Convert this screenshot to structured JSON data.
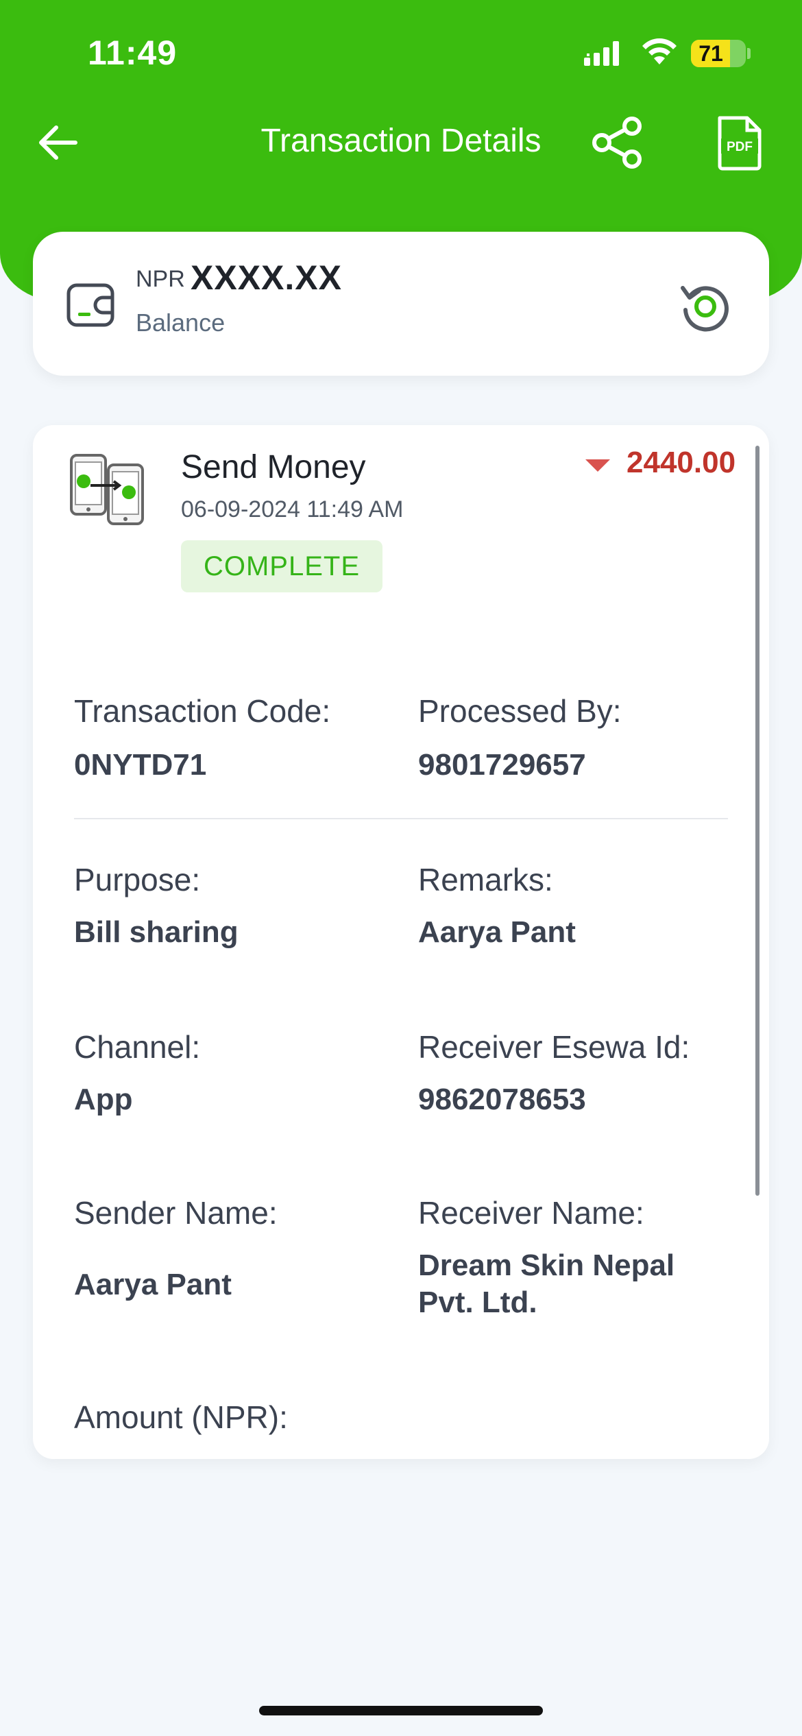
{
  "status_bar": {
    "time": "11:49",
    "battery": "71"
  },
  "nav": {
    "title": "Transaction Details"
  },
  "balance": {
    "currency": "NPR",
    "amount": "XXXX.XX",
    "label": "Balance"
  },
  "transaction": {
    "title": "Send Money",
    "date": "06-09-2024 11:49 AM",
    "status": "COMPLETE",
    "amount": "2440.00",
    "fields": {
      "code_label": "Transaction Code:",
      "code_value": "0NYTD71",
      "processed_label": "Processed By:",
      "processed_value": "9801729657",
      "purpose_label": "Purpose:",
      "purpose_value": "Bill sharing",
      "remarks_label": "Remarks:",
      "remarks_value": "Aarya Pant",
      "channel_label": "Channel:",
      "channel_value": "App",
      "receiver_id_label": "Receiver Esewa Id:",
      "receiver_id_value": "9862078653",
      "sender_label": "Sender Name:",
      "sender_value": "Aarya Pant",
      "receiver_name_label": "Receiver Name:",
      "receiver_name_line1": "Dream Skin Nepal",
      "receiver_name_line2": "Pvt. Ltd.",
      "amount_label": "Amount (NPR):"
    }
  },
  "colors": {
    "brand_green": "#3bbc0f",
    "debit_red": "#c0342b",
    "status_green": "#35b418"
  },
  "icons": [
    "back-arrow-icon",
    "share-icon",
    "pdf-icon",
    "wallet-icon",
    "refresh-icon",
    "send-money-icon",
    "down-arrow-icon"
  ]
}
